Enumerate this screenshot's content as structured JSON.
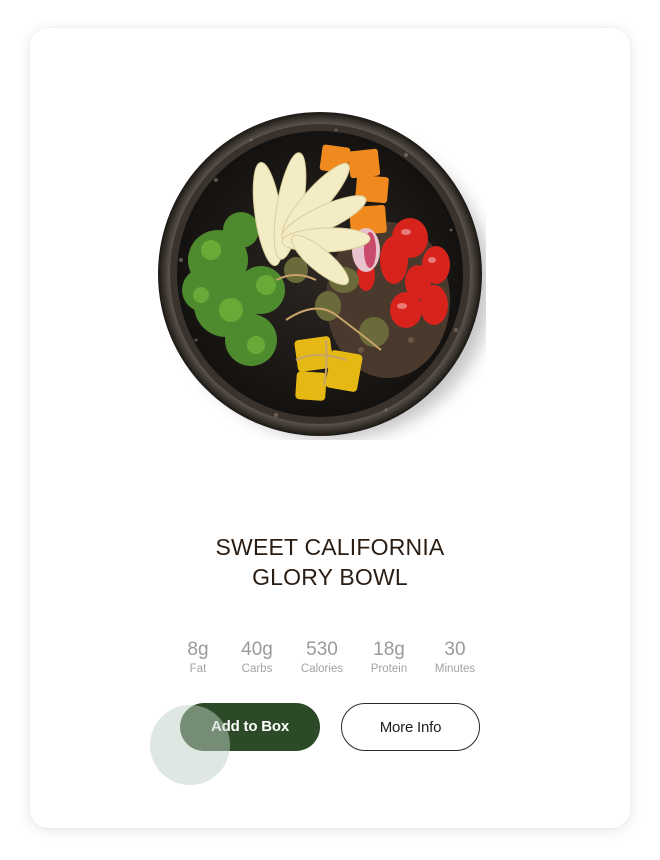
{
  "product": {
    "title_line1": "SWEET CALIFORNIA",
    "title_line2": "GLORY BOWL",
    "image": "salad-bowl"
  },
  "stats": [
    {
      "value": "8g",
      "label": "Fat"
    },
    {
      "value": "40g",
      "label": "Carbs"
    },
    {
      "value": "530",
      "label": "Calories"
    },
    {
      "value": "18g",
      "label": "Protein"
    },
    {
      "value": "30",
      "label": "Minutes"
    }
  ],
  "actions": {
    "add_label": "Add to Box",
    "more_label": "More Info"
  },
  "colors": {
    "primary_button": "#2c4a27",
    "title_text": "#2a1d14",
    "stat_text": "#9a9a9a"
  }
}
